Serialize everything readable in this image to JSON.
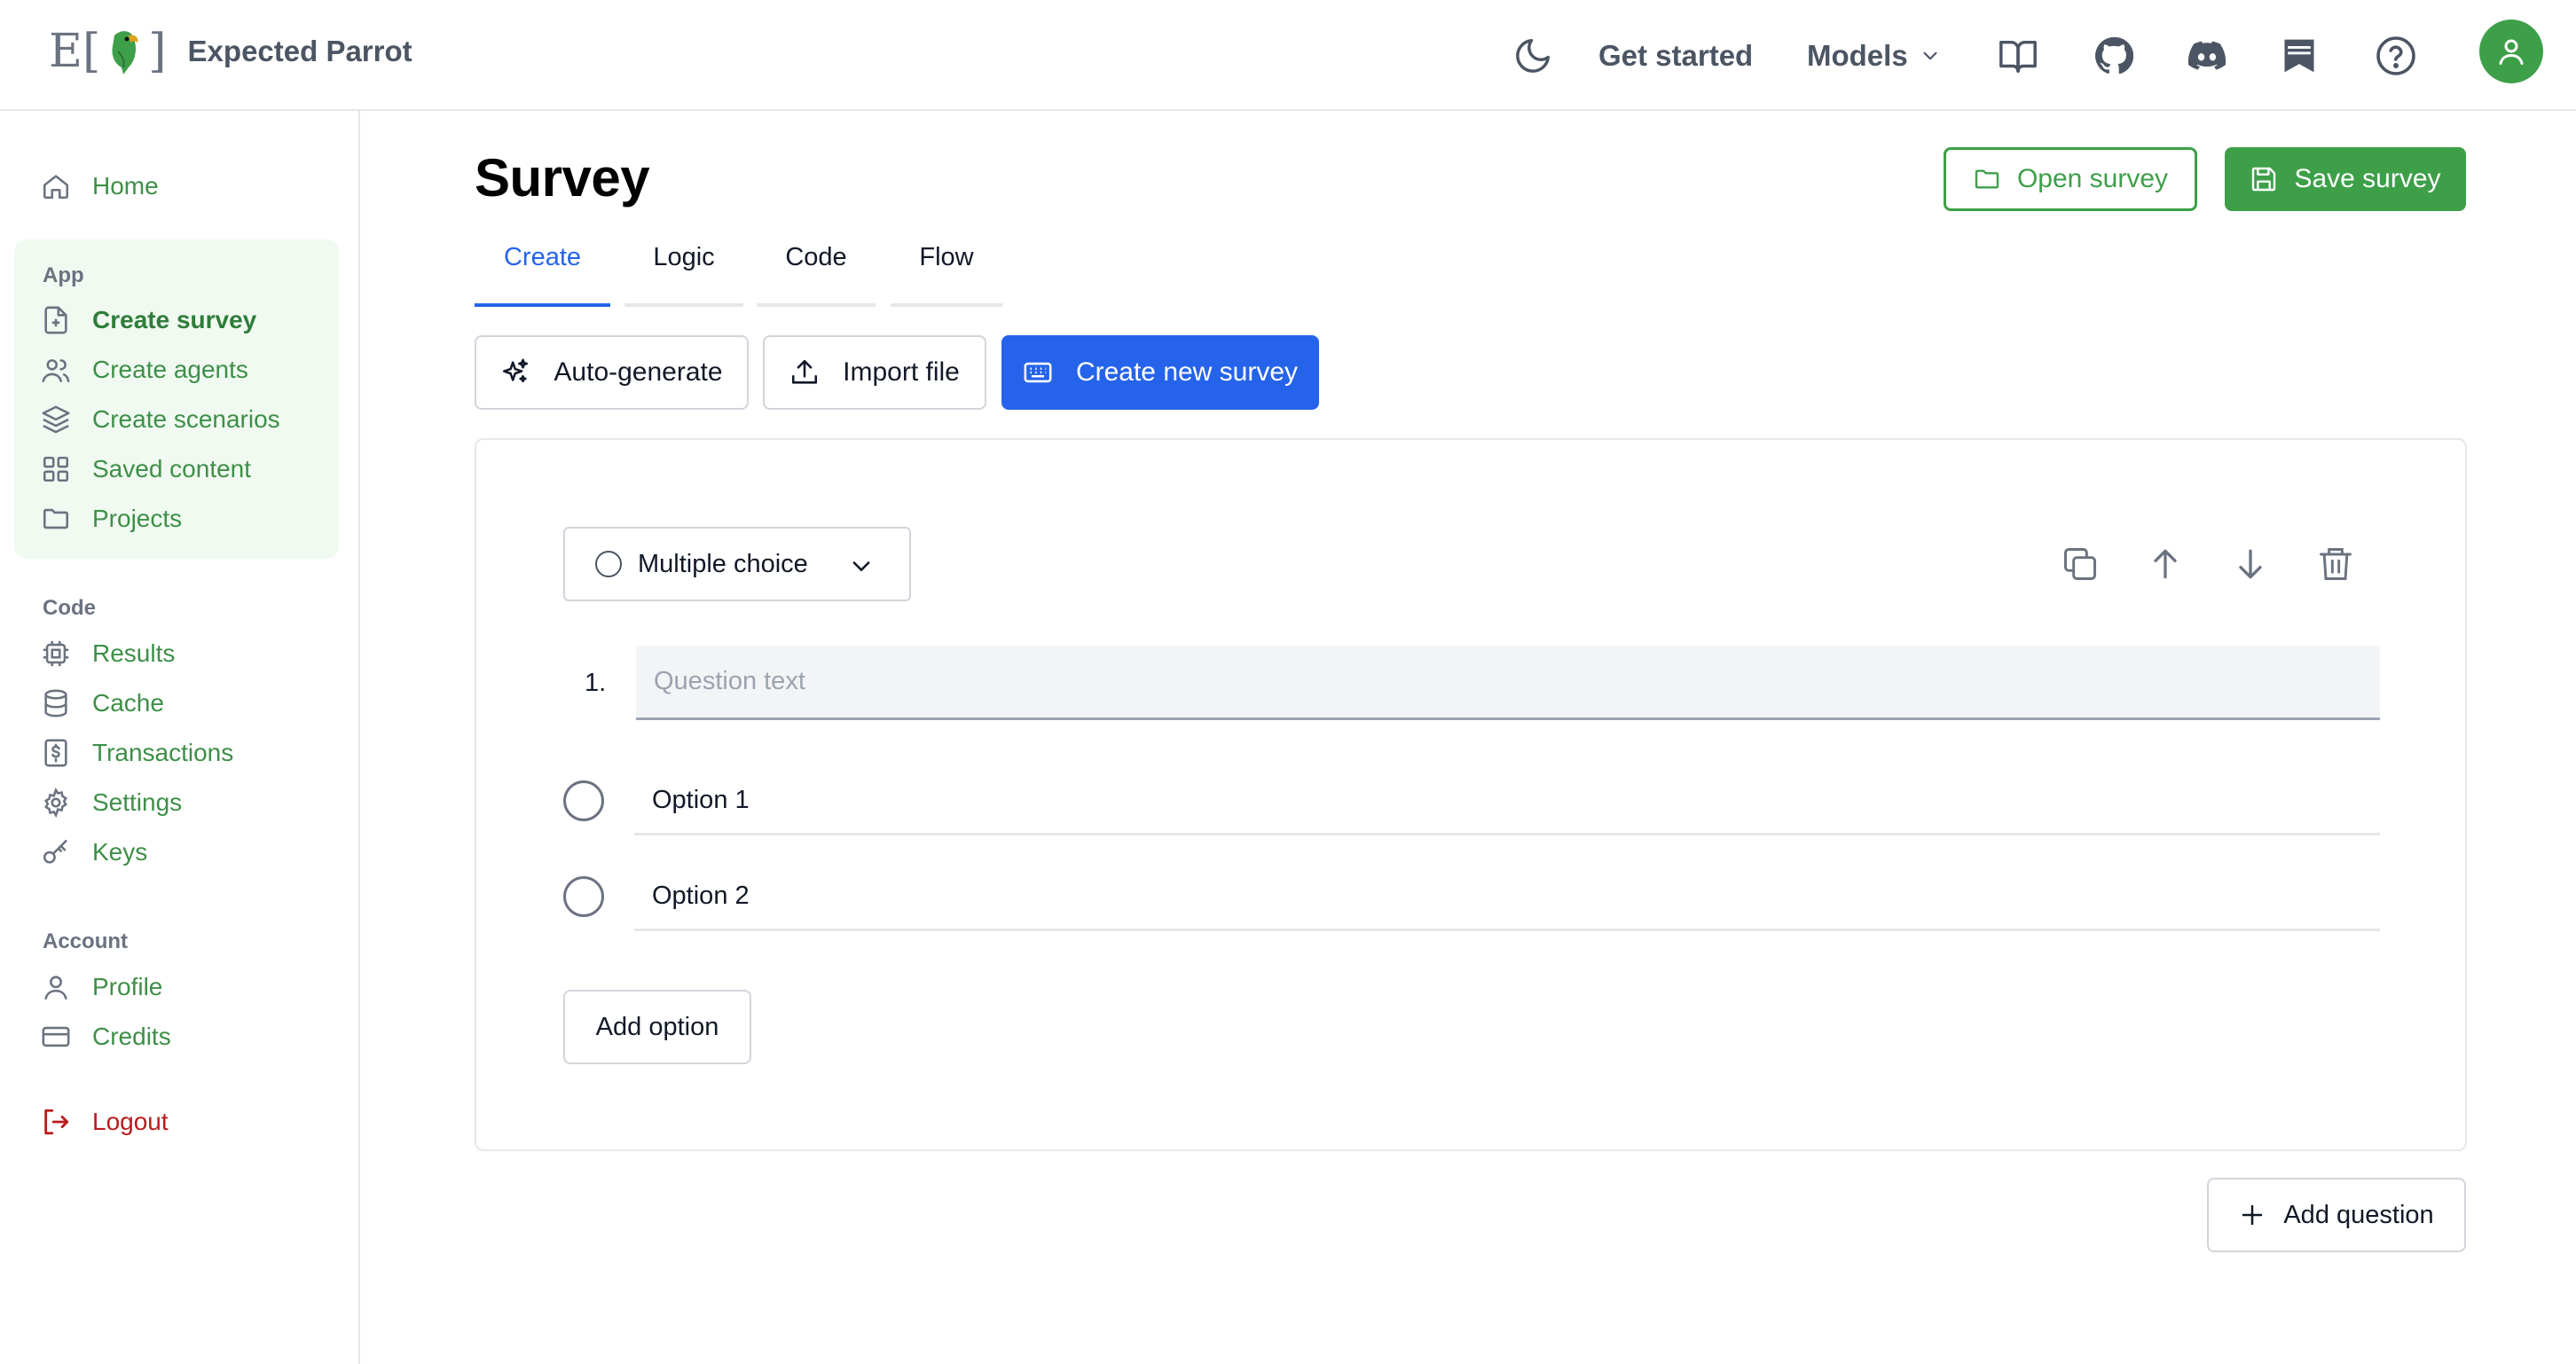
{
  "header": {
    "logo_letters": {
      "left": "E[",
      "right": "]"
    },
    "brand": "Expected Parrot",
    "get_started": "Get started",
    "models": "Models",
    "icons": [
      "moon-icon",
      "book-icon",
      "github-icon",
      "discord-icon",
      "bookmark-icon",
      "help-icon",
      "user-icon"
    ]
  },
  "sidebar": {
    "home": "Home",
    "app_heading": "App",
    "app_items": [
      {
        "label": "Create survey",
        "icon": "file-plus-icon",
        "active": true
      },
      {
        "label": "Create agents",
        "icon": "users-icon"
      },
      {
        "label": "Create scenarios",
        "icon": "layers-icon"
      },
      {
        "label": "Saved content",
        "icon": "grid-icon"
      },
      {
        "label": "Projects",
        "icon": "folder-icon"
      }
    ],
    "code_heading": "Code",
    "code_items": [
      {
        "label": "Results",
        "icon": "chip-icon"
      },
      {
        "label": "Cache",
        "icon": "database-icon"
      },
      {
        "label": "Transactions",
        "icon": "dollar-file-icon"
      },
      {
        "label": "Settings",
        "icon": "gear-icon"
      },
      {
        "label": "Keys",
        "icon": "key-icon"
      }
    ],
    "account_heading": "Account",
    "account_items": [
      {
        "label": "Profile",
        "icon": "user-icon"
      },
      {
        "label": "Credits",
        "icon": "credit-card-icon"
      }
    ],
    "logout": "Logout"
  },
  "main": {
    "title": "Survey",
    "open_survey": "Open survey",
    "save_survey": "Save survey",
    "tabs": [
      {
        "label": "Create",
        "active": true
      },
      {
        "label": "Logic"
      },
      {
        "label": "Code"
      },
      {
        "label": "Flow"
      }
    ],
    "mode_buttons": {
      "auto_generate": "Auto-generate",
      "import_file": "Import file",
      "create_new": "Create new survey"
    },
    "question": {
      "type": "Multiple choice",
      "number": "1.",
      "placeholder": "Question text",
      "options": [
        "Option 1",
        "Option 2"
      ],
      "add_option": "Add option"
    },
    "add_question": "Add question"
  },
  "colors": {
    "brand_green": "#3e9f49",
    "link_green": "#3e8f48",
    "primary_blue": "#2563eb",
    "logout_red": "#b91c1c",
    "sidebar_active_bg": "#f0faf1"
  }
}
